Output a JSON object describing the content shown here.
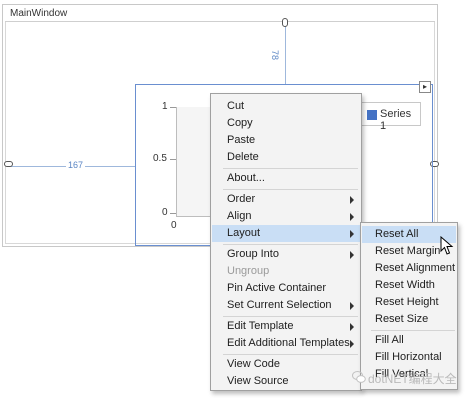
{
  "window": {
    "title": "MainWindow"
  },
  "adorners": {
    "top_margin": "78",
    "left_margin": "167"
  },
  "chart": {
    "y_ticks": [
      "1",
      "0.5",
      "0"
    ],
    "x_ticks": [
      "0"
    ],
    "legend": {
      "series_name": "Series 1",
      "series_color": "#4472c4"
    },
    "selection_color": "#6a8fd0"
  },
  "context_menu": {
    "items": [
      {
        "label": "Cut"
      },
      {
        "label": "Copy"
      },
      {
        "label": "Paste"
      },
      {
        "label": "Delete"
      },
      {
        "label": "About..."
      },
      {
        "label": "Order"
      },
      {
        "label": "Align"
      },
      {
        "label": "Layout"
      },
      {
        "label": "Group Into"
      },
      {
        "label": "Ungroup"
      },
      {
        "label": "Pin Active Container"
      },
      {
        "label": "Set Current Selection"
      },
      {
        "label": "Edit Template"
      },
      {
        "label": "Edit Additional Templates"
      },
      {
        "label": "View Code"
      },
      {
        "label": "View Source"
      }
    ],
    "highlight_color": "#c9def5"
  },
  "layout_submenu": {
    "items": [
      {
        "label": "Reset All"
      },
      {
        "label": "Reset Margin"
      },
      {
        "label": "Reset Alignment"
      },
      {
        "label": "Reset Width"
      },
      {
        "label": "Reset Height"
      },
      {
        "label": "Reset Size"
      },
      {
        "label": "Fill All"
      },
      {
        "label": "Fill Horizontal"
      },
      {
        "label": "Fill Vertical"
      }
    ]
  },
  "watermark": {
    "text": "dotNET编程大全",
    "icon": "wechat-icon"
  }
}
